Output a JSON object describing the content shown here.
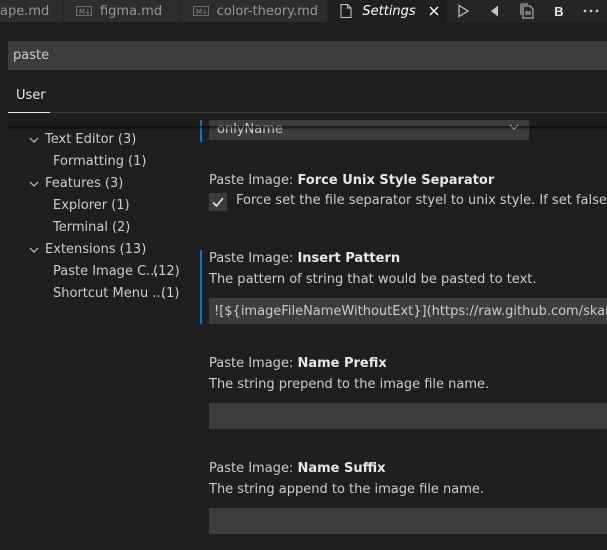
{
  "tabs": [
    {
      "label": "ape.md",
      "icon": "markdown-icon",
      "active": false
    },
    {
      "label": "figma.md",
      "icon": "markdown-icon",
      "active": false
    },
    {
      "label": "color-theory.md",
      "icon": "markdown-icon",
      "active": false
    },
    {
      "label": "Settings",
      "icon": "file-icon",
      "active": true
    }
  ],
  "toolbar": {
    "bold_label": "B",
    "icons": [
      "close-icon",
      "run-icon",
      "go-back-icon",
      "open-preview-icon",
      "bold-icon",
      "more-icon"
    ]
  },
  "search": {
    "value": "paste"
  },
  "scope": {
    "user_label": "User"
  },
  "toc": [
    {
      "label": "Text Editor",
      "count": "(3)",
      "expanded": true
    },
    {
      "label": "Formatting",
      "count": "(1)"
    },
    {
      "label": "Features",
      "count": "(3)",
      "expanded": true
    },
    {
      "label": "Explorer",
      "count": "(1)"
    },
    {
      "label": "Terminal",
      "count": "(2)"
    },
    {
      "label": "Extensions",
      "count": "(13)",
      "expanded": true
    },
    {
      "label": "Paste Image C...",
      "count": "(12)"
    },
    {
      "label": "Shortcut Menu ...",
      "count": "(1)"
    }
  ],
  "settings": {
    "partial_select_value": "onlyName",
    "force_unix": {
      "category": "Paste Image: ",
      "key": "Force Unix Style Separator",
      "checked": true,
      "description": "Force set the file separator styel to unix style. If set false, separator"
    },
    "insert_pattern": {
      "category": "Paste Image: ",
      "key": "Insert Pattern",
      "description": "The pattern of string that would be pasted to text.",
      "value": "![${imageFileNameWithoutExt}](https://raw.github.com/skandasoft/G"
    },
    "name_prefix": {
      "category": "Paste Image: ",
      "key": "Name Prefix",
      "description": "The string prepend to the image file name.",
      "value": ""
    },
    "name_suffix": {
      "category": "Paste Image: ",
      "key": "Name Suffix",
      "description": "The string append to the image file name.",
      "value": ""
    }
  },
  "colors": {
    "accent": "#007acc",
    "background": "#1e1e1e",
    "input_background": "#3c3c3c"
  }
}
